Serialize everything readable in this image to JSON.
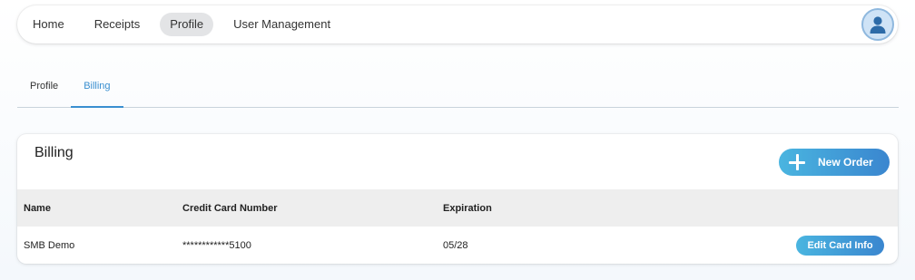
{
  "nav": {
    "items": [
      {
        "label": "Home"
      },
      {
        "label": "Receipts"
      },
      {
        "label": "Profile"
      },
      {
        "label": "User Management"
      }
    ],
    "active_index": 2,
    "avatar_icon": "user-avatar-icon"
  },
  "subtabs": {
    "items": [
      {
        "label": "Profile"
      },
      {
        "label": "Billing"
      }
    ],
    "active_index": 1
  },
  "billing": {
    "title": "Billing",
    "new_order_label": "New Order",
    "table": {
      "headers": [
        "Name",
        "Credit Card Number",
        "Expiration"
      ],
      "rows": [
        {
          "name": "SMB Demo",
          "card_number": "************5100",
          "expiration": "05/28",
          "action_label": "Edit Card Info"
        }
      ]
    }
  },
  "colors": {
    "accent": "#3a8fd0",
    "button_gradient_start": "#4ab5e0",
    "button_gradient_end": "#3a86cf"
  }
}
